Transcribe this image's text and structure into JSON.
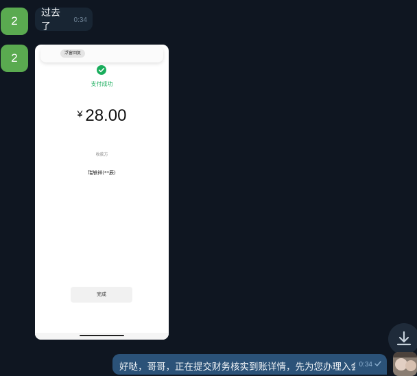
{
  "conversation": {
    "messages": [
      {
        "avatar_initial": "2",
        "text": "过去了",
        "time": "0:34"
      },
      {
        "avatar_initial": "2",
        "photo": {
          "floating_chip": "浮窗回复",
          "status": "支付成功",
          "currency": "¥",
          "amount": "28.00",
          "payee_label": "收款方",
          "payee_name": "瑞轶祥(**辰)",
          "done_button": "完成",
          "accent_color": "#19ad5c"
        }
      }
    ],
    "outgoing": {
      "text": "好哒，哥哥，正在提交财务核实到账详情，先为您办理入会",
      "time": "0:34"
    }
  },
  "icons": {
    "scroll_down": "download-arrow-icon",
    "read_receipt": "check-icon",
    "success": "check-circle-icon"
  },
  "colors": {
    "background": "#0f1621",
    "avatar": "#5aaa50",
    "incoming_bubble": "#182533",
    "outgoing_bubble": "#2b5278"
  }
}
